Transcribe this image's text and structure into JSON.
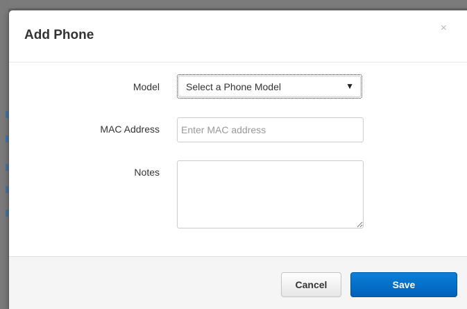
{
  "modal": {
    "title": "Add Phone",
    "close_glyph": "×"
  },
  "form": {
    "model": {
      "label": "Model",
      "selected_value": "Select a Phone Model",
      "arrow_glyph": "▼"
    },
    "mac_address": {
      "label": "MAC Address",
      "placeholder": "Enter MAC address",
      "value": ""
    },
    "notes": {
      "label": "Notes",
      "value": ""
    }
  },
  "footer": {
    "cancel_label": "Cancel",
    "save_label": "Save"
  },
  "colors": {
    "primary_button": "#0a6fc9",
    "overlay": "#6a6a6a"
  }
}
